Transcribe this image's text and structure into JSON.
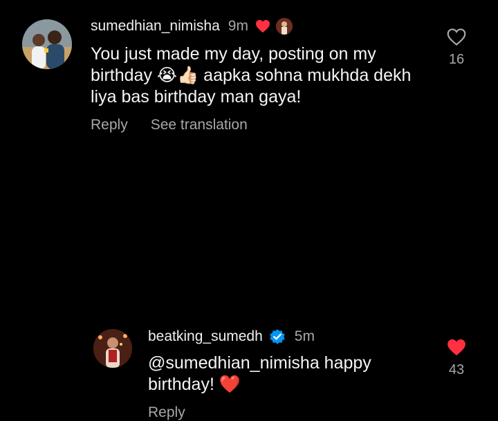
{
  "comments": [
    {
      "username": "sumedhian_nimisha",
      "time": "9m",
      "text": "You just made my day, posting on my birthday 😭👍🏻 aapka sohna mukhda dekh liya bas birthday man gaya!",
      "actions": {
        "reply": "Reply",
        "translate": "See translation"
      },
      "likes": "16",
      "liked": false,
      "liked_by_author": true
    },
    {
      "username": "beatking_sumedh",
      "time": "5m",
      "verified": true,
      "text": "@sumedhian_nimisha happy birthday! ❤️",
      "actions": {
        "reply": "Reply"
      },
      "likes": "43",
      "liked": true
    }
  ],
  "colors": {
    "background": "#000000",
    "text": "#f5f5f5",
    "secondary": "#a8a8a8",
    "like_red": "#ff3040",
    "verified_blue": "#0095f6"
  }
}
